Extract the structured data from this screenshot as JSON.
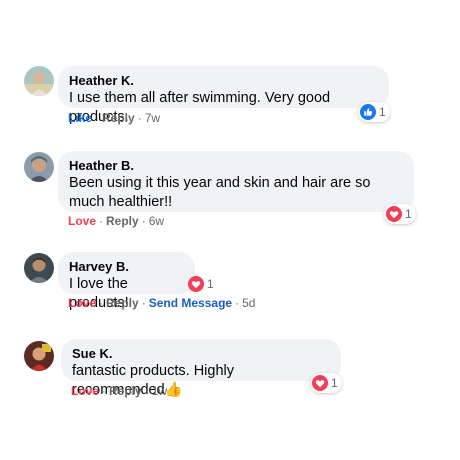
{
  "comments": [
    {
      "name": "Heather K.",
      "text": "I use them all after swimming. Very good products.",
      "action": "Like",
      "reply": "Reply",
      "time": "7w",
      "reaction_type": "like",
      "reaction_count": "1"
    },
    {
      "name": "Heather B.",
      "text": "Been using it this year and skin and hair are so much healthier!!",
      "action": "Love",
      "reply": "Reply",
      "time": "6w",
      "reaction_type": "love",
      "reaction_count": "1"
    },
    {
      "name": "Harvey B.",
      "text": "I love the products!",
      "action": "Love",
      "reply": "Reply",
      "send": "Send Message",
      "time": "5d",
      "reaction_type": "love",
      "reaction_count": "1"
    },
    {
      "name": "Sue K.",
      "text": "fantastic products. Highly recommended👍",
      "action": "Love",
      "reply": "Reply",
      "time": "1w",
      "reaction_type": "love",
      "reaction_count": "1"
    }
  ],
  "colors": {
    "love": "#f33e58",
    "like": "#1877f2",
    "send_message": "#1b5fc1",
    "bubble": "#f0f2f5",
    "meta": "#65676b"
  },
  "icons": {
    "like": "thumbs-up-icon",
    "love": "heart-icon"
  }
}
